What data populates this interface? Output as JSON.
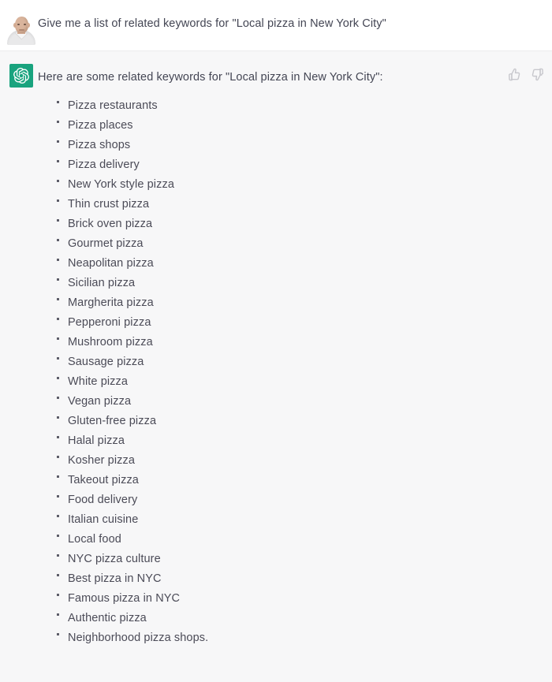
{
  "conversation": {
    "user_turn": {
      "avatar_name": "user-avatar-photo",
      "message": "Give me a list of related keywords for \"Local pizza in New York City\""
    },
    "assistant_turn": {
      "avatar_name": "openai-logo-icon",
      "brand_color": "#19a37e",
      "heading": "Here are some related keywords for \"Local pizza in New York City\":",
      "keywords": [
        "Pizza restaurants",
        "Pizza places",
        "Pizza shops",
        "Pizza delivery",
        "New York style pizza",
        "Thin crust pizza",
        "Brick oven pizza",
        "Gourmet pizza",
        "Neapolitan pizza",
        "Sicilian pizza",
        "Margherita pizza",
        "Pepperoni pizza",
        "Mushroom pizza",
        "Sausage pizza",
        "White pizza",
        "Vegan pizza",
        "Gluten-free pizza",
        "Halal pizza",
        "Kosher pizza",
        "Takeout pizza",
        "Food delivery",
        "Italian cuisine",
        "Local food",
        "NYC pizza culture",
        "Best pizza in NYC",
        "Famous pizza in NYC",
        "Authentic pizza",
        "Neighborhood pizza shops."
      ],
      "feedback": {
        "thumbs_up_label": "thumbs-up",
        "thumbs_down_label": "thumbs-down",
        "icon_color": "#c8c8cd"
      }
    }
  }
}
